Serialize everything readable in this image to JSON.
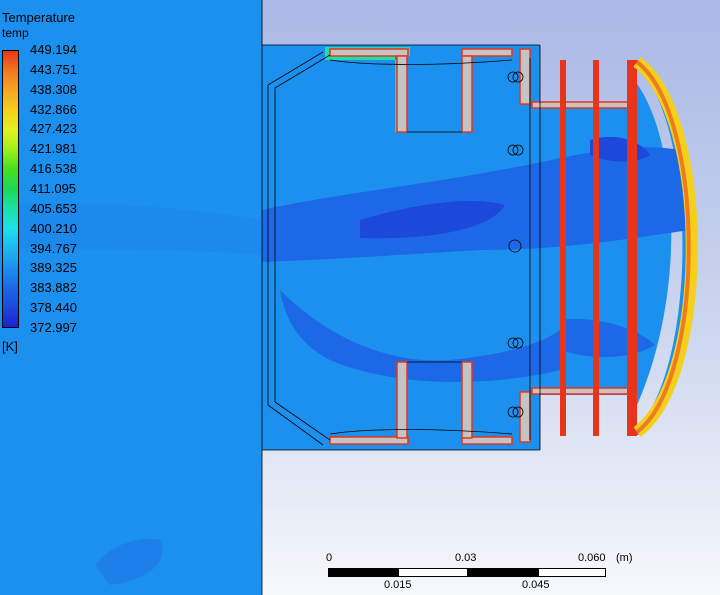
{
  "legend": {
    "title": "Temperature",
    "variable": "temp",
    "unit": "[K]",
    "ticks": [
      "449.194",
      "443.751",
      "438.308",
      "432.866",
      "427.423",
      "421.981",
      "416.538",
      "411.095",
      "405.653",
      "400.210",
      "394.767",
      "389.325",
      "383.882",
      "378.440",
      "372.997"
    ],
    "colors": [
      "#e8341a",
      "#f07a1e",
      "#f5a623",
      "#f4d01c",
      "#e5f01e",
      "#9ff01a",
      "#46e01c",
      "#1cd858",
      "#1ce0a8",
      "#1ce0e8",
      "#1cb8f0",
      "#1c90ee",
      "#1c68e6",
      "#1c48dc",
      "#1c22d2"
    ]
  },
  "scale_bar": {
    "top_labels": [
      "0",
      "0.03",
      "0.060"
    ],
    "bottom_labels": [
      "0.015",
      "0.045"
    ],
    "unit": "(m)"
  },
  "colors": {
    "fluid_background": "#1c90ee",
    "cool_region": "#1c68e6",
    "coldest_core": "#1c48dc",
    "hot_wall": "#e8341a",
    "solid_gray": "#c4c4c4"
  }
}
